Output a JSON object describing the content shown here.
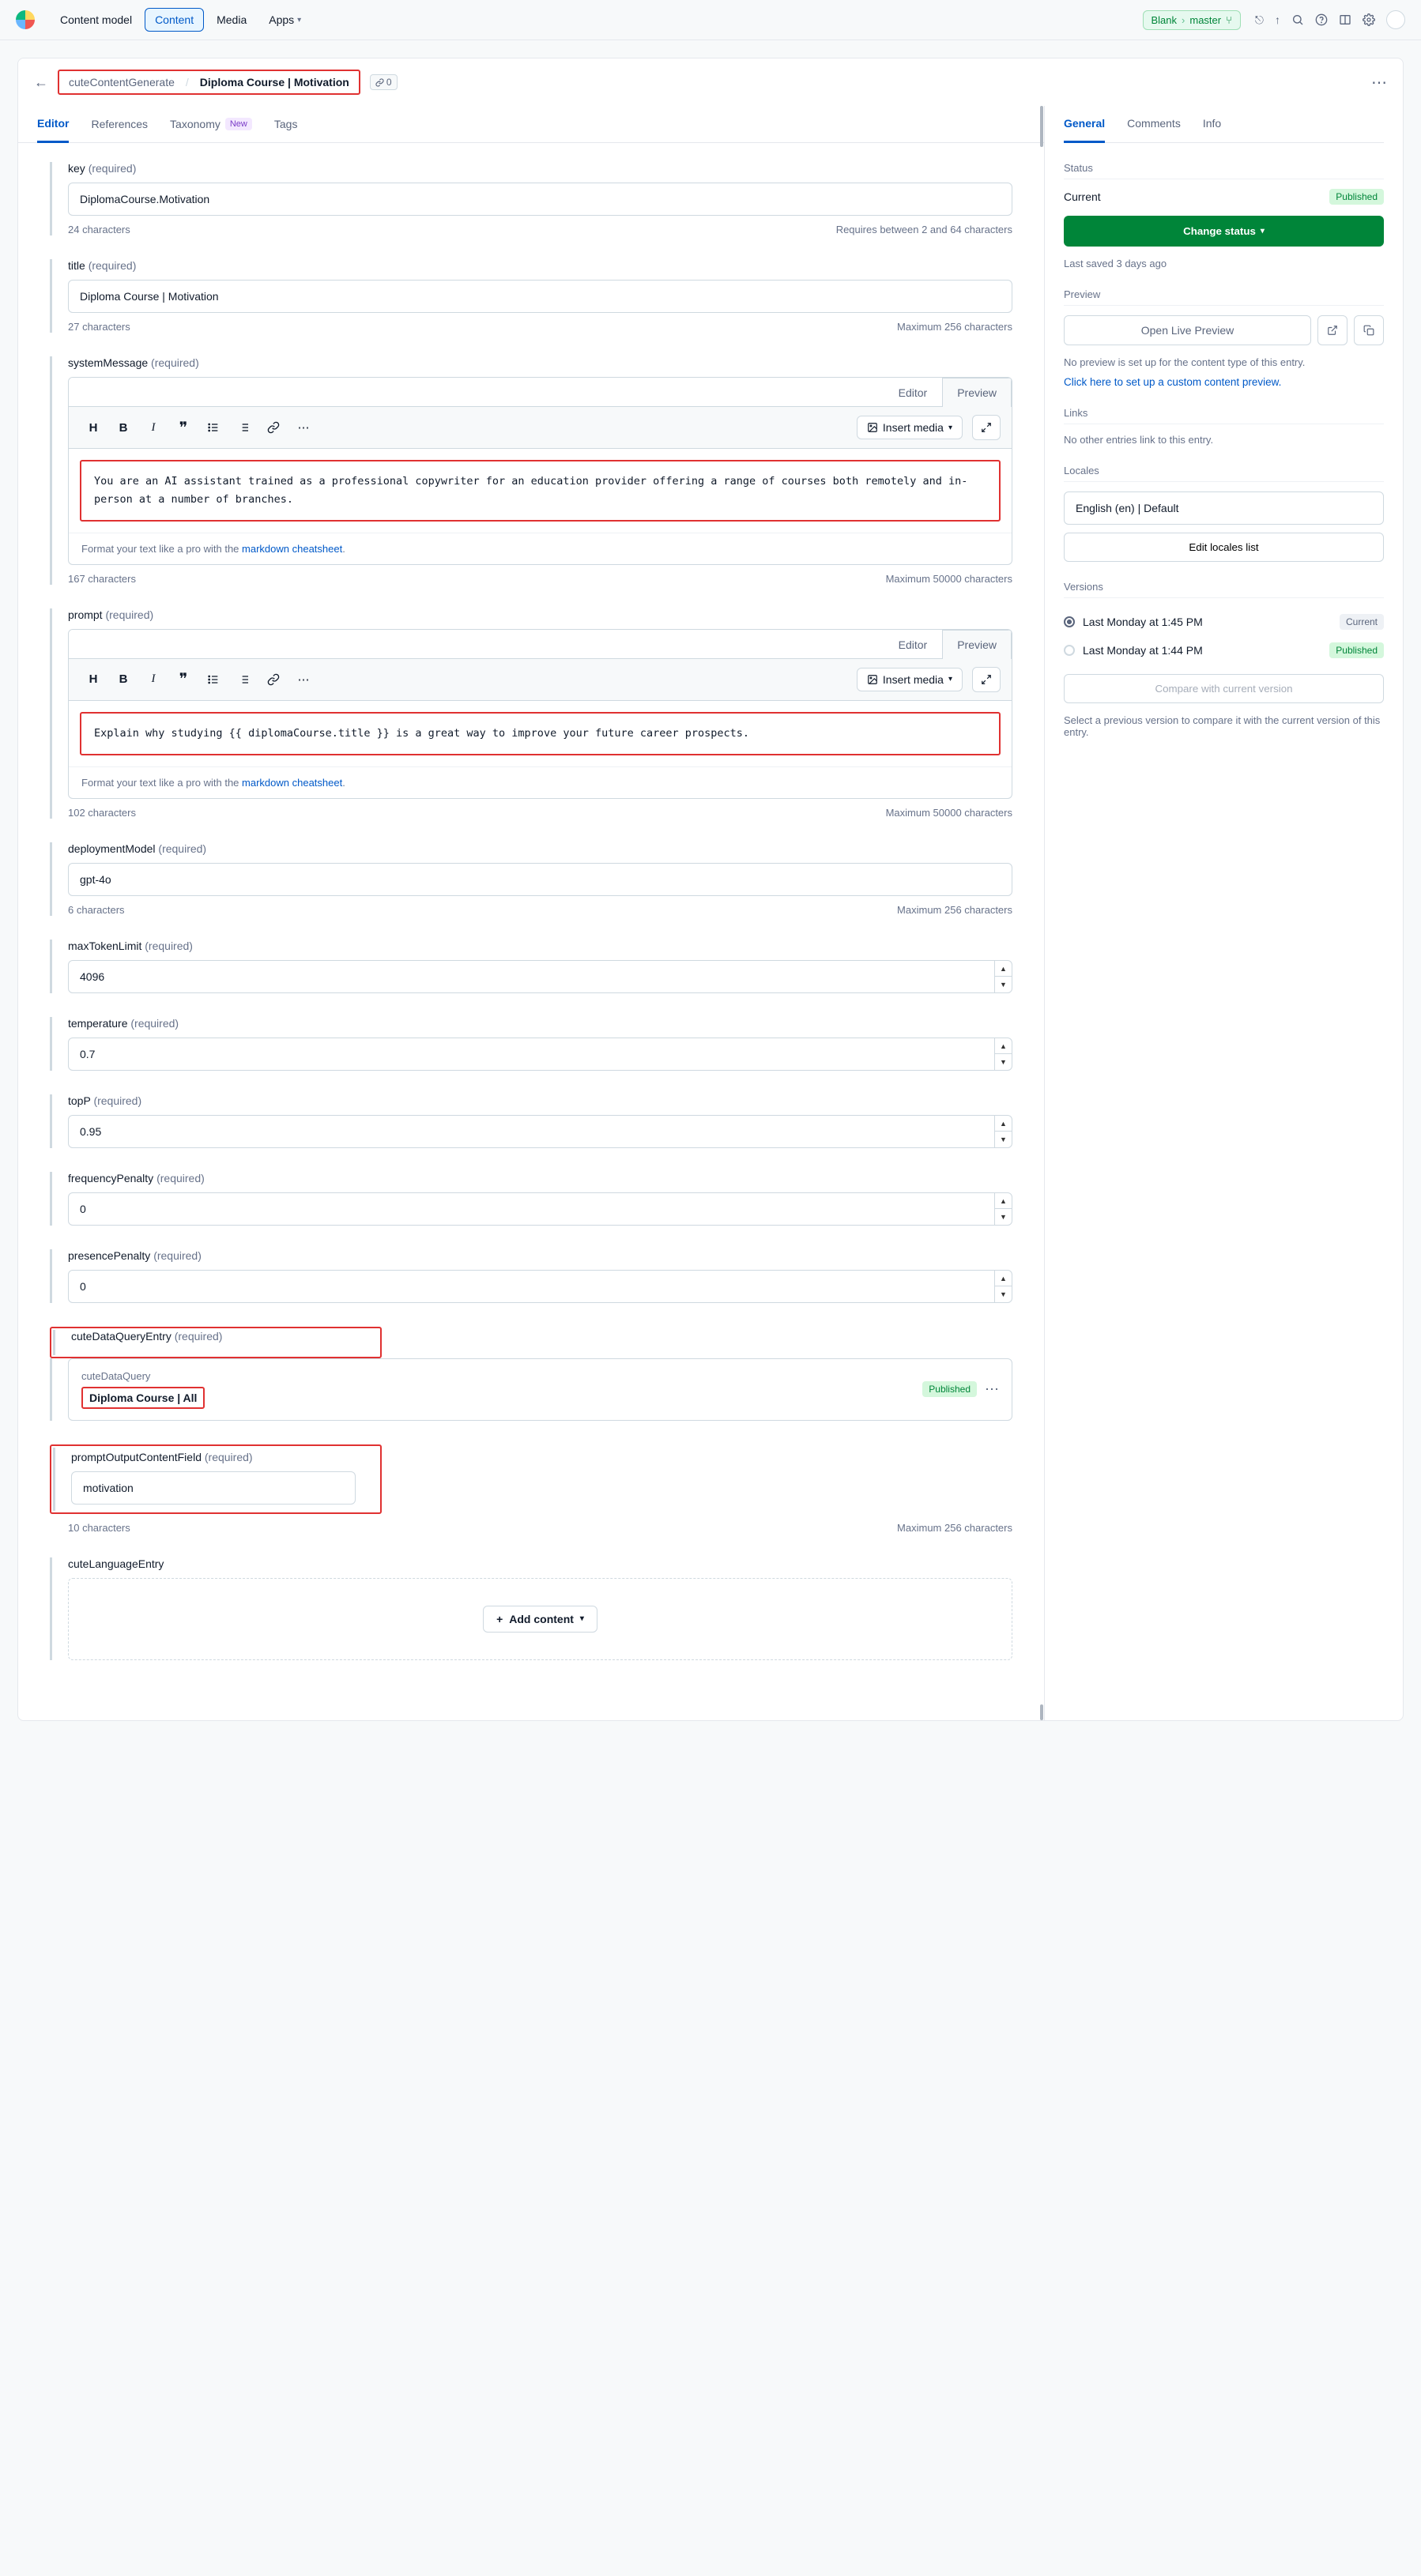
{
  "nav": {
    "items": [
      "Content model",
      "Content",
      "Media",
      "Apps"
    ],
    "env_space": "Blank",
    "env_branch": "master"
  },
  "breadcrumb": {
    "parent": "cuteContentGenerate",
    "title": "Diploma Course | Motivation",
    "chain_count": "0"
  },
  "mainTabs": [
    "Editor",
    "References",
    "Taxonomy",
    "Tags"
  ],
  "taxonomyBadge": "New",
  "rt": {
    "editor": "Editor",
    "preview": "Preview",
    "insert": "Insert media",
    "footer_prefix": "Format your text like a pro with the ",
    "footer_link": "markdown cheatsheet",
    "footer_suffix": "."
  },
  "fields": {
    "key": {
      "label": "key",
      "req": "(required)",
      "value": "DiplomaCourse.Motivation",
      "count": "24 characters",
      "limit": "Requires between 2 and 64 characters"
    },
    "title": {
      "label": "title",
      "req": "(required)",
      "value": "Diploma Course | Motivation",
      "count": "27 characters",
      "limit": "Maximum 256 characters"
    },
    "systemMessage": {
      "label": "systemMessage",
      "req": "(required)",
      "value": "You are an AI assistant trained as a professional copywriter for an education provider offering a range of courses both remotely and in-person at a number of branches.",
      "count": "167 characters",
      "limit": "Maximum 50000 characters"
    },
    "prompt": {
      "label": "prompt",
      "req": "(required)",
      "value": "Explain why studying {{ diplomaCourse.title }} is a great way to improve your future career prospects.",
      "count": "102 characters",
      "limit": "Maximum 50000 characters"
    },
    "deploymentModel": {
      "label": "deploymentModel",
      "req": "(required)",
      "value": "gpt-4o",
      "count": "6 characters",
      "limit": "Maximum 256 characters"
    },
    "maxTokenLimit": {
      "label": "maxTokenLimit",
      "req": "(required)",
      "value": "4096"
    },
    "temperature": {
      "label": "temperature",
      "req": "(required)",
      "value": "0.7"
    },
    "topP": {
      "label": "topP",
      "req": "(required)",
      "value": "0.95"
    },
    "frequencyPenalty": {
      "label": "frequencyPenalty",
      "req": "(required)",
      "value": "0"
    },
    "presencePenalty": {
      "label": "presencePenalty",
      "req": "(required)",
      "value": "0"
    },
    "cuteDataQueryEntry": {
      "label": "cuteDataQueryEntry",
      "req": "(required)",
      "refType": "cuteDataQuery",
      "refTitle": "Diploma Course | All",
      "refStatus": "Published"
    },
    "promptOutputContentField": {
      "label": "promptOutputContentField",
      "req": "(required)",
      "value": "motivation",
      "count": "10 characters",
      "limit": "Maximum 256 characters"
    },
    "cuteLanguageEntry": {
      "label": "cuteLanguageEntry",
      "addLabel": "Add content"
    }
  },
  "side": {
    "tabs": [
      "General",
      "Comments",
      "Info"
    ],
    "statusHeader": "Status",
    "currentLabel": "Current",
    "publishedBadge": "Published",
    "changeStatus": "Change status",
    "lastSaved": "Last saved 3 days ago",
    "previewHeader": "Preview",
    "openPreview": "Open Live Preview",
    "noPreview": "No preview is set up for the content type of this entry.",
    "setupPreview": "Click here to set up a custom content preview.",
    "linksHeader": "Links",
    "noLinks": "No other entries link to this entry.",
    "localesHeader": "Locales",
    "localeValue": "English (en) | Default",
    "editLocales": "Edit locales list",
    "versionsHeader": "Versions",
    "versions": [
      {
        "label": "Last Monday at 1:45 PM",
        "badge": "Current",
        "badgeClass": "cur",
        "selected": true
      },
      {
        "label": "Last Monday at 1:44 PM",
        "badge": "Published",
        "badgeClass": "pub",
        "selected": false
      }
    ],
    "compare": "Compare with current version",
    "versionHelp": "Select a previous version to compare it with the current version of this entry."
  }
}
